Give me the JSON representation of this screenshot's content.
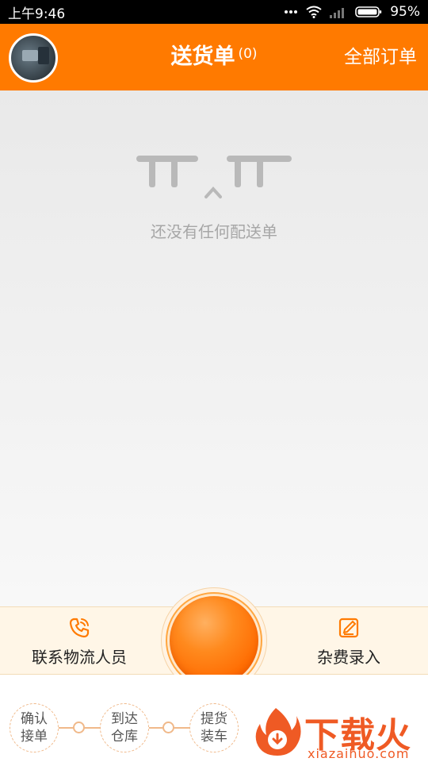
{
  "status_bar": {
    "time": "上午9:46",
    "battery_percent": "95%",
    "icons": [
      "more-dots-icon",
      "wifi-icon",
      "signal-icon",
      "battery-icon"
    ]
  },
  "header": {
    "title": "送货单",
    "count": "(0)",
    "all_orders": "全部订单",
    "avatar_icon": "user-avatar"
  },
  "empty_state": {
    "text": "还没有任何配送单",
    "icon": "crying-face-icon"
  },
  "actions": {
    "contact": {
      "label": "联系物流人员",
      "icon": "phone-icon"
    },
    "expense": {
      "label": "杂费录入",
      "icon": "edit-note-icon"
    },
    "main_button": {
      "icon": "orange-circle-button"
    }
  },
  "steps": [
    {
      "line1": "确认",
      "line2": "接单"
    },
    {
      "line1": "到达",
      "line2": "仓库"
    },
    {
      "line1": "提货",
      "line2": "装车"
    }
  ],
  "watermark": {
    "text": "下载火",
    "sub": "xiazaihuo.com"
  },
  "colors": {
    "brand_orange": "#ff7a00",
    "action_bar_bg": "#fff6e7",
    "empty_text": "#a6a6a6",
    "watermark": "#ef5a24"
  }
}
